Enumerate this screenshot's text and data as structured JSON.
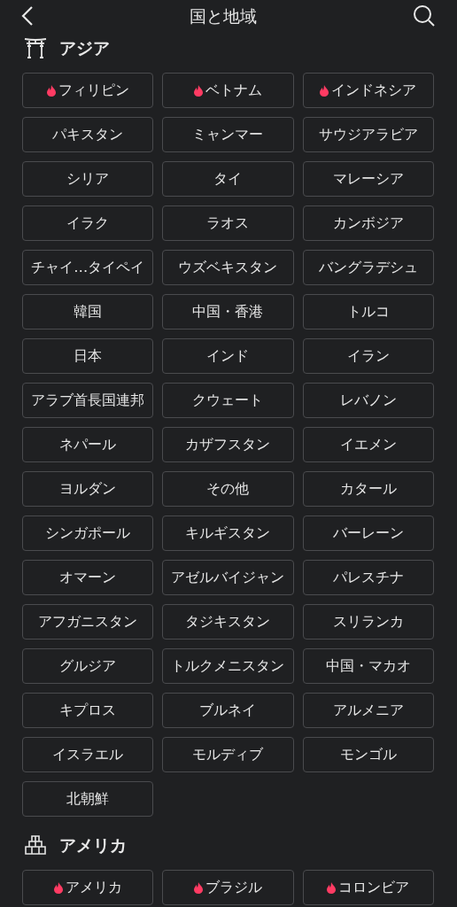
{
  "header": {
    "title": "国と地域"
  },
  "sections": [
    {
      "kind": "asia",
      "title": "アジア",
      "items": [
        {
          "label": "フィリピン",
          "hot": true
        },
        {
          "label": "ベトナム",
          "hot": true
        },
        {
          "label": "インドネシア",
          "hot": true
        },
        {
          "label": "パキスタン",
          "hot": false
        },
        {
          "label": "ミャンマー",
          "hot": false
        },
        {
          "label": "サウジアラビア",
          "hot": false
        },
        {
          "label": "シリア",
          "hot": false
        },
        {
          "label": "タイ",
          "hot": false
        },
        {
          "label": "マレーシア",
          "hot": false
        },
        {
          "label": "イラク",
          "hot": false
        },
        {
          "label": "ラオス",
          "hot": false
        },
        {
          "label": "カンボジア",
          "hot": false
        },
        {
          "label": "チャイ…タイペイ",
          "hot": false
        },
        {
          "label": "ウズベキスタン",
          "hot": false
        },
        {
          "label": "バングラデシュ",
          "hot": false
        },
        {
          "label": "韓国",
          "hot": false
        },
        {
          "label": "中国・香港",
          "hot": false
        },
        {
          "label": "トルコ",
          "hot": false
        },
        {
          "label": "日本",
          "hot": false
        },
        {
          "label": "インド",
          "hot": false
        },
        {
          "label": "イラン",
          "hot": false
        },
        {
          "label": "アラブ首長国連邦",
          "hot": false
        },
        {
          "label": "クウェート",
          "hot": false
        },
        {
          "label": "レバノン",
          "hot": false
        },
        {
          "label": "ネパール",
          "hot": false
        },
        {
          "label": "カザフスタン",
          "hot": false
        },
        {
          "label": "イエメン",
          "hot": false
        },
        {
          "label": "ヨルダン",
          "hot": false
        },
        {
          "label": "その他",
          "hot": false
        },
        {
          "label": "カタール",
          "hot": false
        },
        {
          "label": "シンガポール",
          "hot": false
        },
        {
          "label": "キルギスタン",
          "hot": false
        },
        {
          "label": "バーレーン",
          "hot": false
        },
        {
          "label": "オマーン",
          "hot": false
        },
        {
          "label": "アゼルバイジャン",
          "hot": false
        },
        {
          "label": "パレスチナ",
          "hot": false
        },
        {
          "label": "アフガニスタン",
          "hot": false
        },
        {
          "label": "タジキスタン",
          "hot": false
        },
        {
          "label": "スリランカ",
          "hot": false
        },
        {
          "label": "グルジア",
          "hot": false
        },
        {
          "label": "トルクメニスタン",
          "hot": false
        },
        {
          "label": "中国・マカオ",
          "hot": false
        },
        {
          "label": "キプロス",
          "hot": false
        },
        {
          "label": "ブルネイ",
          "hot": false
        },
        {
          "label": "アルメニア",
          "hot": false
        },
        {
          "label": "イスラエル",
          "hot": false
        },
        {
          "label": "モルディブ",
          "hot": false
        },
        {
          "label": "モンゴル",
          "hot": false
        },
        {
          "label": "北朝鮮",
          "hot": false
        }
      ]
    },
    {
      "kind": "america",
      "title": "アメリカ",
      "items": [
        {
          "label": "アメリカ",
          "hot": true
        },
        {
          "label": "ブラジル",
          "hot": true
        },
        {
          "label": "コロンビア",
          "hot": true
        }
      ]
    }
  ]
}
